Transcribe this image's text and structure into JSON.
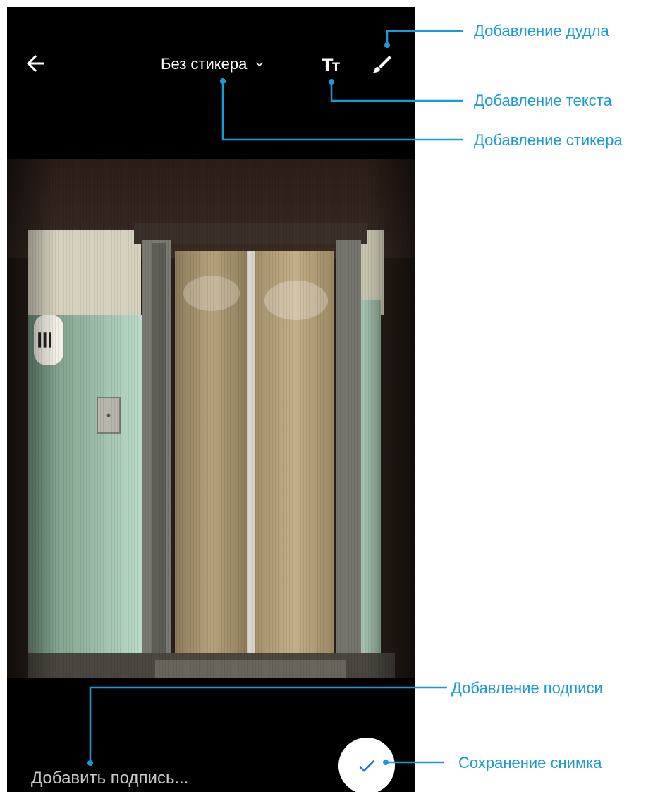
{
  "toolbar": {
    "back_icon": "arrow-left-icon",
    "sticker_label": "Без стикера",
    "sticker_dropdown_icon": "chevron-down-icon",
    "text_icon_big": "T",
    "text_icon_small": "T",
    "doodle_icon": "brush-icon"
  },
  "photo": {
    "subject": "elevator doors"
  },
  "bottom": {
    "caption_placeholder": "Добавить подпись...",
    "save_icon": "checkmark-icon"
  },
  "annotations": {
    "doodle": "Добавление дудла",
    "text": "Добавление текста",
    "sticker": "Добавление стикера",
    "caption": "Добавление подписи",
    "save": "Сохранение снимка"
  },
  "colors": {
    "annotation": "#1a9bd7",
    "accent": "#1a73e8",
    "background": "#000000"
  }
}
